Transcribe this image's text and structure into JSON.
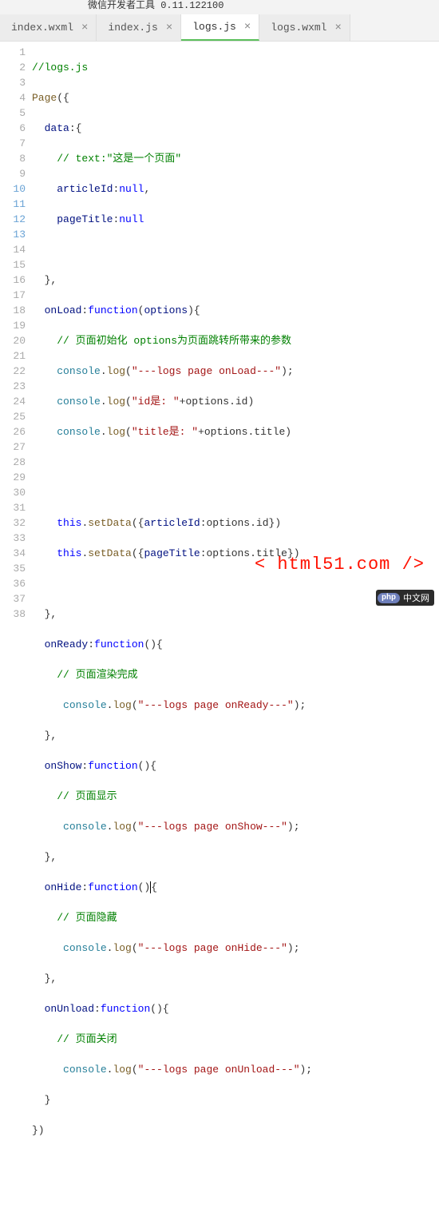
{
  "topbar": {
    "text": "微信开发者工具 0.11.122100"
  },
  "tabs": [
    {
      "label": "index.wxml",
      "active": false
    },
    {
      "label": "index.js",
      "active": false
    },
    {
      "label": "logs.js",
      "active": true
    },
    {
      "label": "logs.wxml",
      "active": false
    }
  ],
  "close_glyph": "×",
  "highlight_lines": [
    10,
    11,
    12,
    13
  ],
  "code": {
    "l1": "//logs.js",
    "l2_fn": "Page",
    "l3_prop": "data",
    "l4": "// text:\"这是一个页面\"",
    "l5_prop": "articleId",
    "l5_val": "null",
    "l6_prop": "pageTitle",
    "l6_val": "null",
    "l9_prop": "onLoad",
    "l9_kw": "function",
    "l9_arg": "options",
    "l10": "// 页面初始化 options为页面跳转所带来的参数",
    "l11_a": "console",
    "l11_b": "log",
    "l11_s": "\"---logs page onLoad---\"",
    "l12_a": "console",
    "l12_b": "log",
    "l12_s": "\"id是: \"",
    "l12_t": "+options.id",
    "l13_a": "console",
    "l13_b": "log",
    "l13_s": "\"title是: \"",
    "l13_t": "+options.title",
    "l16_a": "this",
    "l16_b": "setData",
    "l16_c": "articleId",
    "l16_d": ":options.id",
    "l17_a": "this",
    "l17_b": "setData",
    "l17_c": "pageTitle",
    "l17_d": ":options.title",
    "l20_prop": "onReady",
    "l20_kw": "function",
    "l21": "// 页面渲染完成",
    "l22_a": "console",
    "l22_b": "log",
    "l22_s": "\"---logs page onReady---\"",
    "l24_prop": "onShow",
    "l24_kw": "function",
    "l25": "// 页面显示",
    "l26_a": "console",
    "l26_b": "log",
    "l26_s": "\"---logs page onShow---\"",
    "l28_prop": "onHide",
    "l28_kw": "function",
    "l29": "// 页面隐藏",
    "l30_a": "console",
    "l30_b": "log",
    "l30_s": "\"---logs page onHide---\"",
    "l32_prop": "onUnload",
    "l32_kw": "function",
    "l33": "// 页面关闭",
    "l34_a": "console",
    "l34_b": "log",
    "l34_s": "\"---logs page onUnload---\""
  },
  "watermark": "< html51.com />",
  "logo": {
    "php": "php",
    "text": "中文网"
  },
  "line_count": 38
}
